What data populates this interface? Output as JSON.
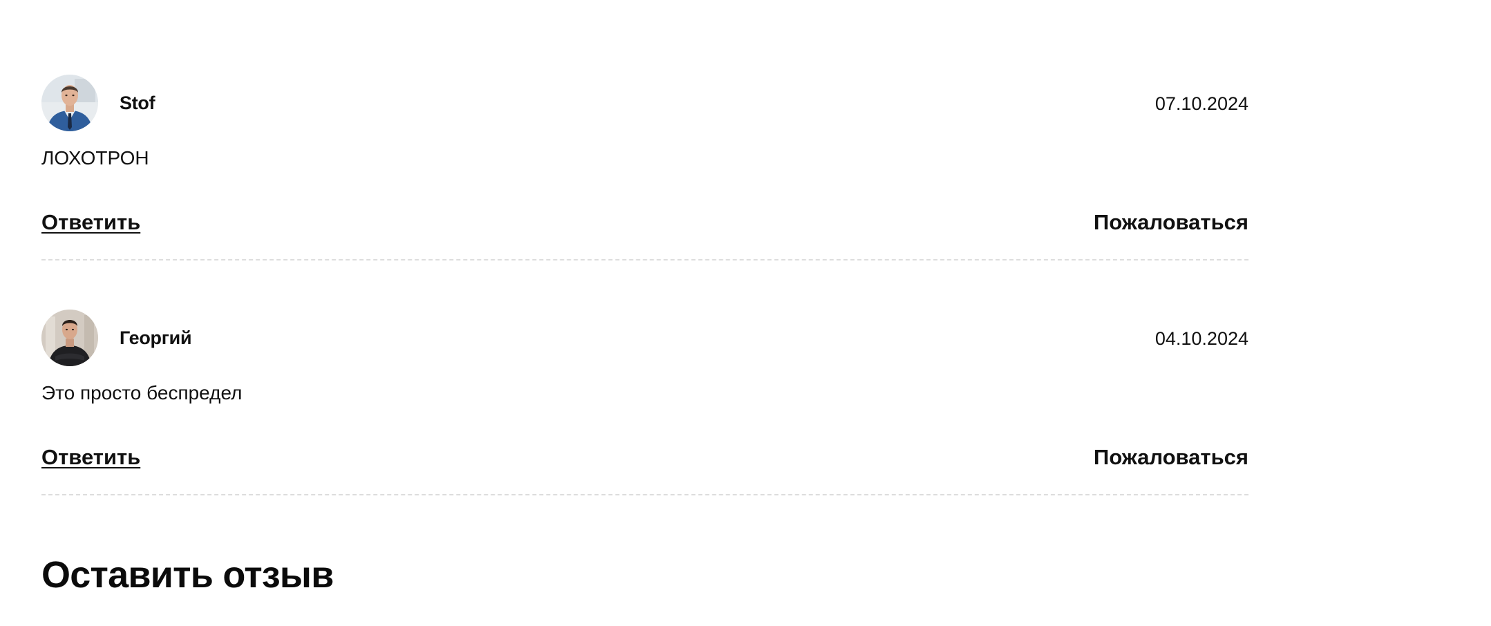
{
  "reviews": [
    {
      "author": "Stof",
      "date": "07.10.2024",
      "text": "ЛОХОТРОН",
      "reply_label": "Ответить",
      "complain_label": "Пожаловаться",
      "avatar_icon": "user-photo-avatar"
    },
    {
      "author": "Георгий",
      "date": "04.10.2024",
      "text": "Это просто беспредел",
      "reply_label": "Ответить",
      "complain_label": "Пожаловаться",
      "avatar_icon": "user-photo-avatar"
    }
  ],
  "leave_review": {
    "title": "Оставить отзыв"
  },
  "colors": {
    "text": "#111111",
    "divider": "#dddddd",
    "background": "#ffffff"
  }
}
